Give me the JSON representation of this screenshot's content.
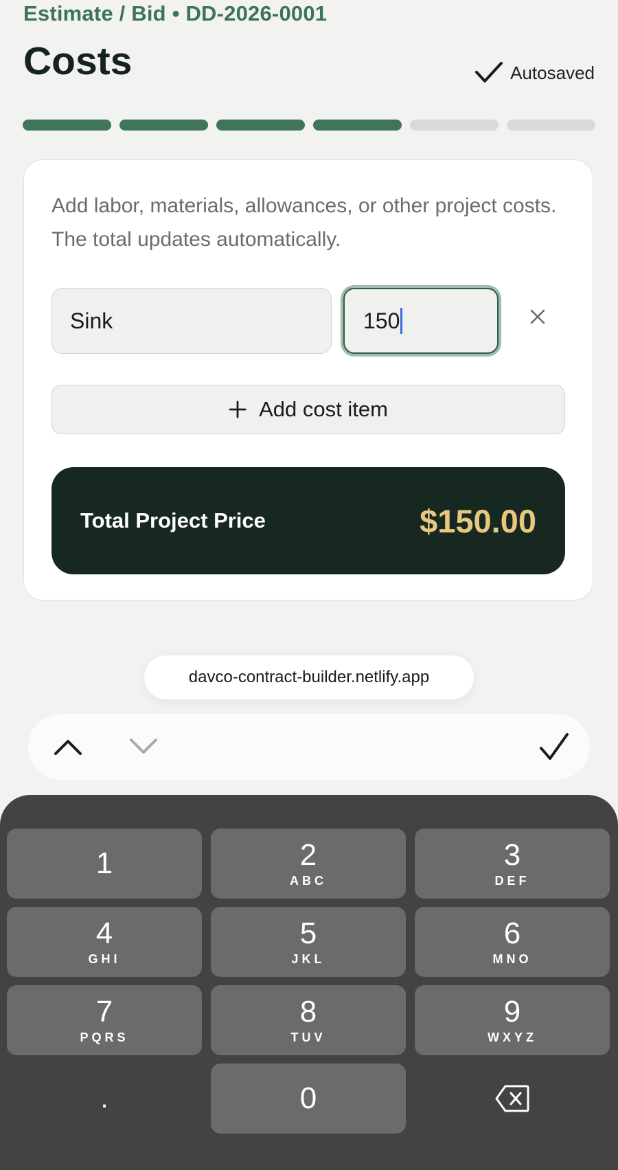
{
  "header": {
    "breadcrumb": "Estimate / Bid • DD-2026-0001",
    "title": "Costs",
    "autosave_label": "Autosaved",
    "progress": {
      "total_steps": 6,
      "completed_steps": 4
    }
  },
  "card": {
    "intro": "Add labor, materials, allowances, or other project costs. The total updates automatically.",
    "items": [
      {
        "name": "Sink",
        "amount": "150"
      }
    ],
    "add_label": "Add cost item",
    "total_label": "Total Project Price",
    "total_value": "$150.00"
  },
  "browser": {
    "url": "davco-contract-builder.netlify.app"
  },
  "keypad": {
    "keys": [
      {
        "digit": "1",
        "letters": ""
      },
      {
        "digit": "2",
        "letters": "ABC"
      },
      {
        "digit": "3",
        "letters": "DEF"
      },
      {
        "digit": "4",
        "letters": "GHI"
      },
      {
        "digit": "5",
        "letters": "JKL"
      },
      {
        "digit": "6",
        "letters": "MNO"
      },
      {
        "digit": "7",
        "letters": "PQRS"
      },
      {
        "digit": "8",
        "letters": "TUV"
      },
      {
        "digit": "9",
        "letters": "WXYZ"
      },
      {
        "digit": ".",
        "letters": ""
      },
      {
        "digit": "0",
        "letters": ""
      }
    ]
  },
  "colors": {
    "brand_green": "#3f7559",
    "total_bg": "#172820",
    "total_accent": "#e8c77e"
  }
}
